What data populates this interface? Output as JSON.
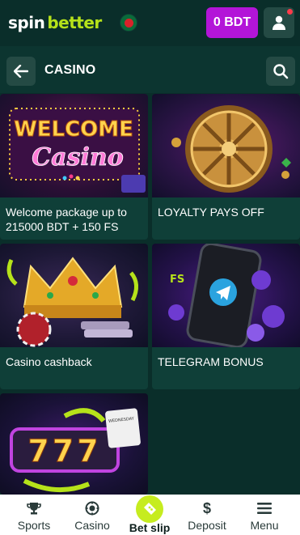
{
  "header": {
    "logo_part1": "spin",
    "logo_part2": "better",
    "balance_label": "0 BDT"
  },
  "subheader": {
    "title": "CASINO"
  },
  "cards": [
    {
      "label": "Welcome package up to 215000 BDT + 150 FS",
      "art_text_top": "WELCOME",
      "art_text_bottom": "Casino"
    },
    {
      "label": "LOYALTY PAYS OFF"
    },
    {
      "label": "Casino cashback"
    },
    {
      "label": "TELEGRAM BONUS",
      "art_badge": "FS"
    },
    {
      "label": "",
      "art_reels": "777",
      "art_calendar": "WEDNESDAY"
    }
  ],
  "bottom_nav": [
    {
      "label": "Sports",
      "icon": "trophy-icon"
    },
    {
      "label": "Casino",
      "icon": "casino-chip-icon"
    },
    {
      "label": "Bet slip",
      "icon": "ticket-icon"
    },
    {
      "label": "Deposit",
      "icon": "dollar-icon"
    },
    {
      "label": "Menu",
      "icon": "hamburger-icon"
    }
  ],
  "colors": {
    "background": "#0a2e2a",
    "accent_green": "#b6e21a",
    "balance_purple": "#b315d8",
    "notification_red": "#ff3b4a"
  }
}
